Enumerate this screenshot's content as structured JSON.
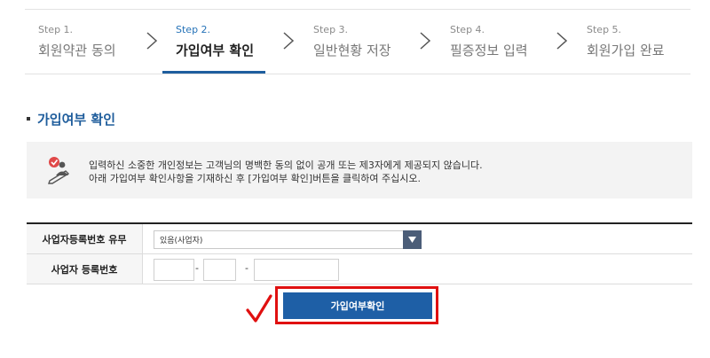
{
  "steps": [
    {
      "num": "Step 1.",
      "name": "회원약관 동의"
    },
    {
      "num": "Step 2.",
      "name": "가입여부 확인"
    },
    {
      "num": "Step 3.",
      "name": "일반현황 저장"
    },
    {
      "num": "Step 4.",
      "name": "필증정보 입력"
    },
    {
      "num": "Step 5.",
      "name": "회원가입 완료"
    }
  ],
  "section_title": "가입여부 확인",
  "notice": {
    "line1": "입력하신 소중한 개인정보는 고객님의 명백한 동의 없이 공개 또는 제3자에게 제공되지 않습니다.",
    "line2": "아래 가입여부 확인사항을 기재하신 후 [가입여부 확인]버튼을 클릭하여 주십시오."
  },
  "form": {
    "reg_exist_label": "사업자등록번호 유무",
    "reg_exist_value": "있음(사업자)",
    "reg_no_label": "사업자 등록번호",
    "sep": "-"
  },
  "button_label": "가입여부확인",
  "colors": {
    "accent": "#1e5fa6",
    "highlight": "#e01010"
  }
}
